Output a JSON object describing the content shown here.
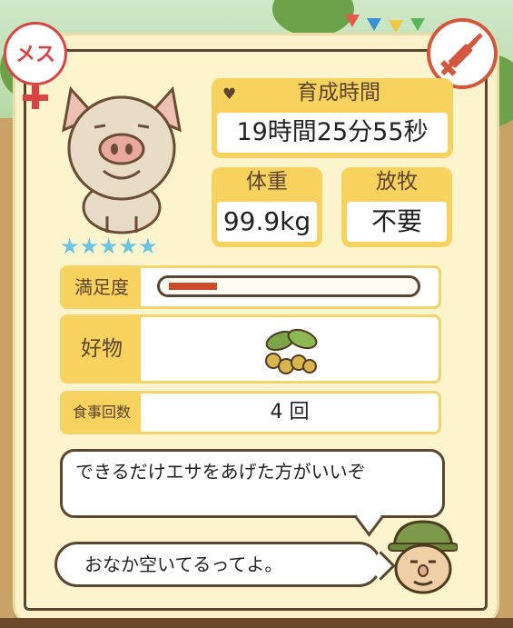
{
  "pig": {
    "gender_badge": "メス",
    "stars": "★★★★★",
    "star_count": 5
  },
  "growth_time": {
    "label": "育成時間",
    "value": "19時間25分55秒"
  },
  "weight": {
    "label": "体重",
    "value": "99.9kg"
  },
  "grazing": {
    "label": "放牧",
    "value": "不要"
  },
  "satisfaction": {
    "label": "満足度",
    "level": 0.2
  },
  "favorite": {
    "label": "好物",
    "icon": "soybean-icon"
  },
  "meals": {
    "label": "食事回数",
    "value": "4 回"
  },
  "dialogue": {
    "line1": "できるだけエサをあげた方がいいぞ",
    "line2": "おなか空いてるってよ。"
  },
  "colors": {
    "accent_yellow": "#f7d25e",
    "gender_red": "#d94346",
    "gauge_red": "#cf4a2a",
    "star_blue": "#6cc3e2"
  }
}
